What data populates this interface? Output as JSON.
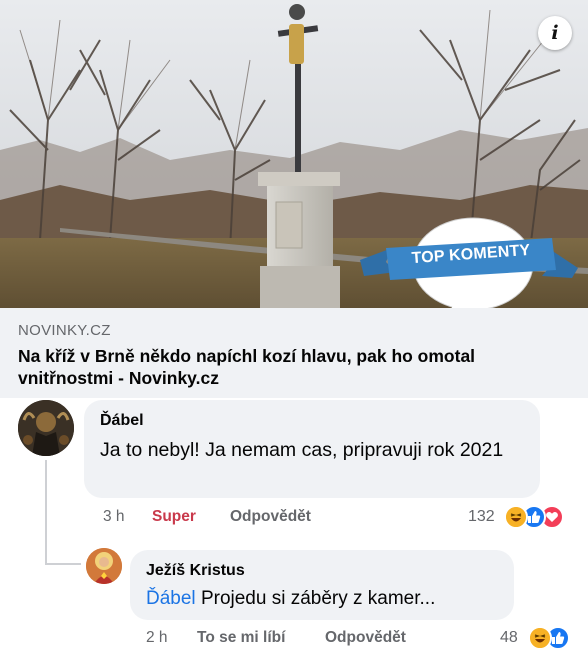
{
  "hero": {
    "badge_text": "TOP KOMENTY",
    "info_icon_glyph": "i"
  },
  "link_preview": {
    "domain": "NOVINKY.CZ",
    "title": "Na kříž v Brně někdo napíchl kozí hlavu, pak ho omotal vnitřnostmi - Novinky.cz"
  },
  "comments": [
    {
      "author": "Ďábel",
      "text": "Ja to nebyl! Ja nemam cas, pripravuji rok 2021",
      "time": "3 h",
      "reaction_label": "Super",
      "reply_label": "Odpovědět",
      "reaction_count": "132",
      "reactions": [
        "haha-icon",
        "like-icon",
        "love-icon"
      ],
      "accent_color": "#c9394b"
    },
    {
      "author": "Ježíš Kristus",
      "mention": "Ďábel",
      "text": "Projedu si záběry z kamer...",
      "time": "2 h",
      "reaction_label": "To se mi líbí",
      "reply_label": "Odpovědět",
      "reaction_count": "48",
      "reactions": [
        "haha-icon",
        "like-icon"
      ]
    }
  ],
  "colors": {
    "bubble": "#f0f2f5",
    "meta_text": "#65676b",
    "link": "#1b74e4",
    "badge": "#3a86c8"
  }
}
